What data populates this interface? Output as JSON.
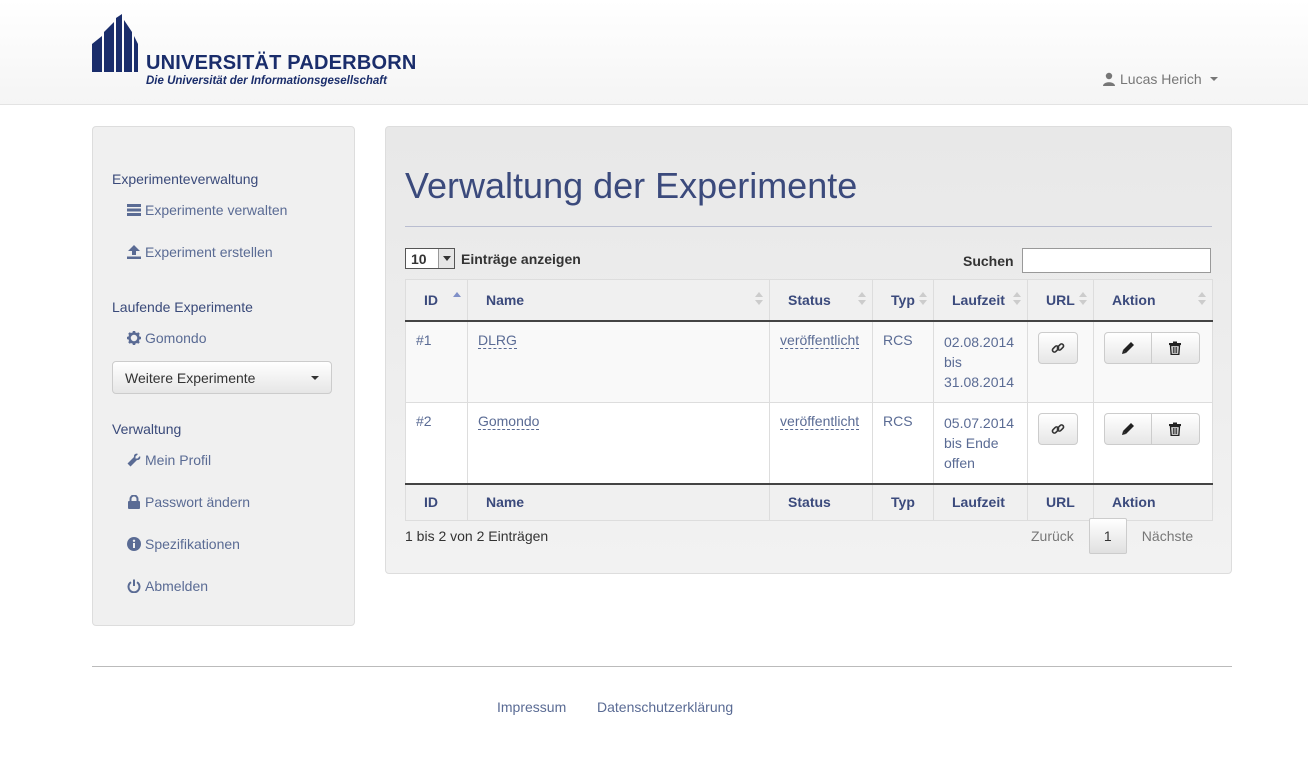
{
  "header": {
    "logo_title": "UNIVERSITÄT PADERBORN",
    "logo_subtitle": "Die Universität der Informationsgesellschaft",
    "user_name": "Lucas Herich"
  },
  "sidebar": {
    "sections": [
      {
        "heading": "Experimenteverwaltung"
      },
      {
        "heading": "Laufende Experimente"
      },
      {
        "heading": "Verwaltung"
      }
    ],
    "items": [
      {
        "label": "Experimente verwalten",
        "icon": "list-icon"
      },
      {
        "label": "Experiment erstellen",
        "icon": "upload-icon"
      },
      {
        "label": "Gomondo",
        "icon": "gear-icon"
      },
      {
        "label": "Mein Profil",
        "icon": "wrench-icon"
      },
      {
        "label": "Passwort ändern",
        "icon": "lock-icon"
      },
      {
        "label": "Spezifikationen",
        "icon": "info-icon"
      },
      {
        "label": "Abmelden",
        "icon": "power-icon"
      }
    ],
    "dropdown_label": "Weitere Experimente"
  },
  "main": {
    "title": "Verwaltung der Experimente",
    "length": {
      "value": "10",
      "label": "Einträge anzeigen"
    },
    "search": {
      "label": "Suchen",
      "value": ""
    },
    "columns": [
      "ID",
      "Name",
      "Status",
      "Typ",
      "Laufzeit",
      "URL",
      "Aktion"
    ],
    "rows": [
      {
        "id": "#1",
        "name": "DLRG",
        "status": "veröffentlicht",
        "typ": "RCS",
        "laufzeit": [
          "02.08.2014",
          "bis",
          "31.08.2014"
        ]
      },
      {
        "id": "#2",
        "name": "Gomondo",
        "status": "veröffentlicht",
        "typ": "RCS",
        "laufzeit": [
          "05.07.2014",
          "bis Ende",
          "offen"
        ]
      }
    ],
    "info": "1 bis 2 von 2 Einträgen",
    "pager": {
      "prev": "Zurück",
      "current": "1",
      "next": "Nächste"
    }
  },
  "footer": {
    "links": [
      "Impressum",
      "Datenschutzerklärung"
    ]
  },
  "colors": {
    "accent": "#3b4a7c",
    "link": "#5a6b94",
    "brand": "#1a2d6b"
  }
}
